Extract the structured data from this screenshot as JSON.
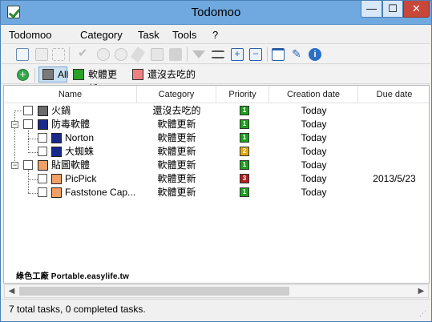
{
  "window": {
    "title": "Todomoo",
    "minimize": "—",
    "maximize": "☐",
    "close": "✕"
  },
  "menu": [
    "Todomoo",
    "Category",
    "Task",
    "Tools",
    "?"
  ],
  "toolbar": {
    "icons": [
      "new-task-icon",
      "edit-icon",
      "move-icon",
      "complete-icon",
      "play-icon",
      "pause-icon",
      "eraser-icon",
      "chart-icon",
      "stop-icon",
      "filter-icon",
      "text-align-icon",
      "expand-all-icon",
      "collapse-all-icon",
      "window-icon",
      "wrench-icon",
      "info-icon"
    ]
  },
  "filters": {
    "add": "+",
    "items": [
      {
        "label": "All",
        "color": "#7a7a7a",
        "active": true
      },
      {
        "label": "軟體更新",
        "color": "#2aa02a",
        "active": false
      },
      {
        "label": "還沒去吃的",
        "color": "#f08080",
        "active": false
      }
    ]
  },
  "columns": [
    "Name",
    "Category",
    "Priority",
    "Creation date",
    "Due date"
  ],
  "tasks": [
    {
      "name": "火鍋",
      "category": "還沒去吃的",
      "priority": "1",
      "priority_color": "#1f9e1f",
      "creation": "Today",
      "due": "",
      "swatch": "#6b6b6b"
    },
    {
      "name": "防毒軟體",
      "category": "軟體更新",
      "priority": "1",
      "priority_color": "#1f9e1f",
      "creation": "Today",
      "due": "",
      "swatch": "#1a2a8a"
    },
    {
      "name": "Norton",
      "category": "軟體更新",
      "priority": "1",
      "priority_color": "#1f9e1f",
      "creation": "Today",
      "due": "",
      "swatch": "#1a2a8a"
    },
    {
      "name": "大蜘蛛",
      "category": "軟體更新",
      "priority": "2",
      "priority_color": "#e0a814",
      "creation": "Today",
      "due": "",
      "swatch": "#1a2a8a"
    },
    {
      "name": "貼圖軟體",
      "category": "軟體更新",
      "priority": "1",
      "priority_color": "#1f9e1f",
      "creation": "Today",
      "due": "",
      "swatch": "#f0a066"
    },
    {
      "name": "PicPick",
      "category": "軟體更新",
      "priority": "3",
      "priority_color": "#b11d1d",
      "creation": "Today",
      "due": "2013/5/23",
      "swatch": "#f0a066"
    },
    {
      "name": "Faststone Cap...",
      "category": "軟體更新",
      "priority": "1",
      "priority_color": "#1f9e1f",
      "creation": "Today",
      "due": "",
      "swatch": "#f0a066"
    }
  ],
  "watermark": "綠色工廠 Portable.easylife.tw",
  "status": "7 total tasks, 0 completed tasks."
}
